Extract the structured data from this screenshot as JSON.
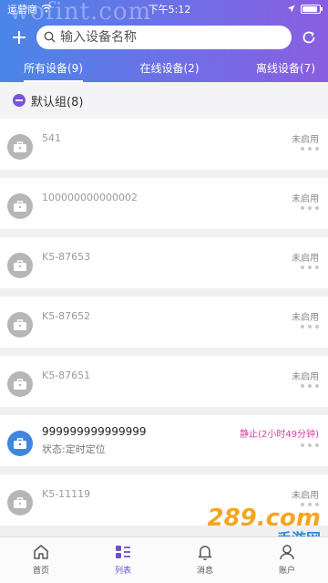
{
  "status_bar": {
    "carrier": "运营商",
    "time": "下午5:12"
  },
  "watermark": "wofint.com",
  "search": {
    "placeholder": "输入设备名称"
  },
  "tabs": [
    {
      "label": "所有设备(9)",
      "active": true
    },
    {
      "label": "在线设备(2)",
      "active": false
    },
    {
      "label": "离线设备(7)",
      "active": false
    }
  ],
  "group": {
    "label": "默认组(8)"
  },
  "devices": [
    {
      "name": "541",
      "state": "未启用",
      "sub": ""
    },
    {
      "name": "100000000000002",
      "state": "未启用",
      "sub": ""
    },
    {
      "name": "K5-87653",
      "state": "未启用",
      "sub": ""
    },
    {
      "name": "K5-87652",
      "state": "未启用",
      "sub": ""
    },
    {
      "name": "K5-87651",
      "state": "未启用",
      "sub": ""
    },
    {
      "name": "999999999999999",
      "state": "静止(2小时49分钟)",
      "sub": "状态:定时定位"
    },
    {
      "name": "K5-11119",
      "state": "未启用",
      "sub": ""
    }
  ],
  "tabbar": [
    {
      "label": "首页",
      "icon": "home-icon"
    },
    {
      "label": "列表",
      "icon": "list-icon"
    },
    {
      "label": "消息",
      "icon": "bell-icon"
    },
    {
      "label": "账户",
      "icon": "user-icon"
    }
  ],
  "corner_watermark": {
    "big": "289.com",
    "small": "手游网"
  },
  "colors": {
    "accent": "#6a4fd0",
    "online_state": "#d23fa8",
    "online_avatar": "#3f86dc"
  }
}
